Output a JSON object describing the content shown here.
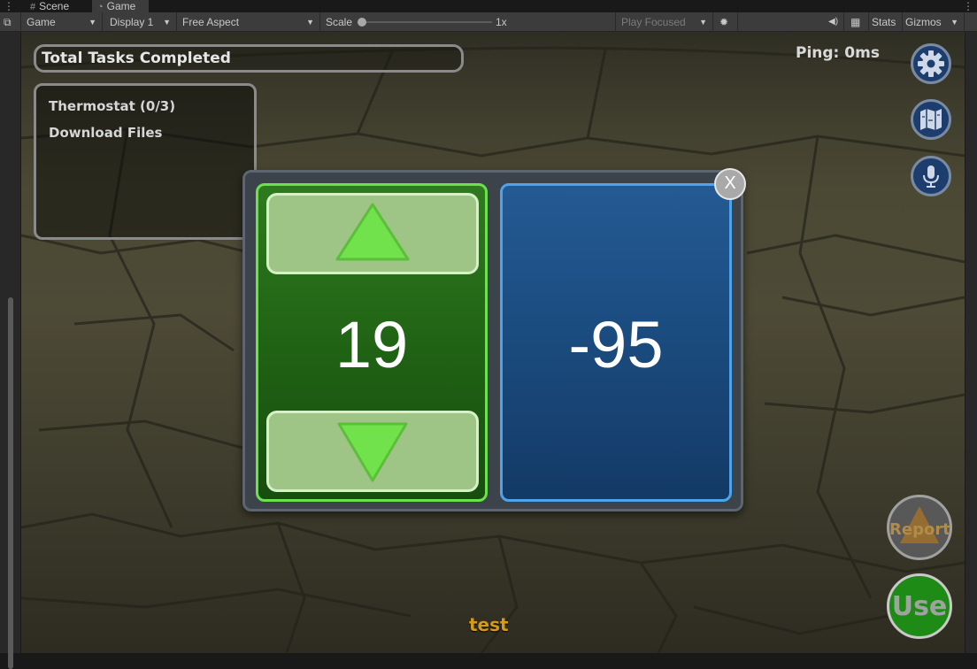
{
  "editor": {
    "tabs": [
      {
        "label": "Scene",
        "icon": "hash-icon"
      },
      {
        "label": "Game",
        "icon": "gamepad-icon"
      }
    ],
    "toolbar": {
      "view_mode": "Game",
      "display": "Display 1",
      "aspect": "Free Aspect",
      "scale_label": "Scale",
      "scale_value": "1x",
      "play_mode": "Play Focused",
      "stats_label": "Stats",
      "gizmos_label": "Gizmos"
    }
  },
  "hud": {
    "tasks_header": "Total Tasks Completed",
    "tasks": [
      "Thermostat (0/3)",
      "Download Files"
    ],
    "ping": "Ping: 0ms",
    "player_name": "test",
    "report_label": "Report",
    "use_label": "Use",
    "colors": {
      "accent_green": "#6be24d",
      "accent_blue": "#4ea3ea",
      "use_green": "#1e8b16"
    }
  },
  "dialog": {
    "green_value": "19",
    "blue_value": "-95",
    "close_label": "X"
  }
}
